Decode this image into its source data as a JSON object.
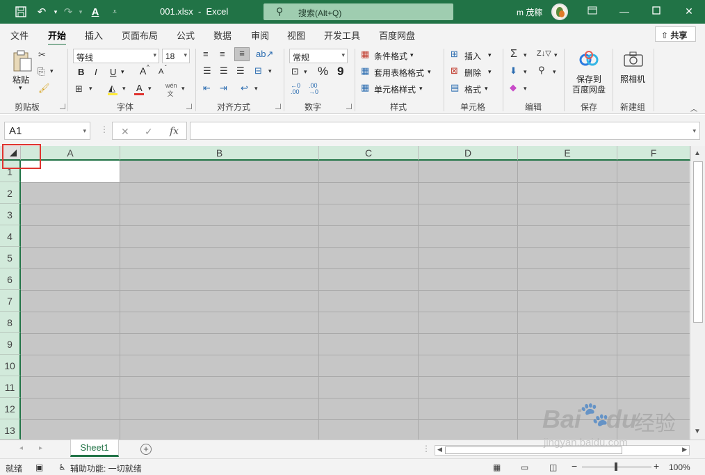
{
  "titlebar": {
    "filename": "001.xlsx",
    "separator": "-",
    "app": "Excel",
    "search_placeholder": "搜索(Alt+Q)",
    "user": "m 茂稼"
  },
  "tabs": [
    "文件",
    "开始",
    "插入",
    "页面布局",
    "公式",
    "数据",
    "审阅",
    "视图",
    "开发工具",
    "百度网盘"
  ],
  "share": "共享",
  "ribbon": {
    "clipboard": {
      "paste": "粘贴",
      "label": "剪贴板"
    },
    "font": {
      "name": "等线",
      "size": "18",
      "bold": "B",
      "italic": "I",
      "underline": "U",
      "grow": "A",
      "shrink": "A",
      "label": "字体"
    },
    "alignment": {
      "label": "对齐方式"
    },
    "number": {
      "format": "常规",
      "percent": "%",
      "comma": "9",
      "label": "数字"
    },
    "styles": {
      "conditional": "条件格式",
      "table": "套用表格格式",
      "cell": "单元格样式",
      "label": "样式"
    },
    "cells": {
      "insert": "插入",
      "delete": "删除",
      "format": "格式",
      "label": "单元格"
    },
    "editing": {
      "label": "编辑"
    },
    "save": {
      "line1": "保存到",
      "line2": "百度网盘",
      "label": "保存"
    },
    "camera": {
      "name": "照相机",
      "label": "新建组"
    }
  },
  "formula_bar": {
    "namebox": "A1",
    "fx": "fx",
    "value": ""
  },
  "columns": [
    "A",
    "B",
    "C",
    "D",
    "E",
    "F"
  ],
  "rows": [
    "1",
    "2",
    "3",
    "4",
    "5",
    "6",
    "7",
    "8",
    "9",
    "10",
    "11",
    "12",
    "13"
  ],
  "sheet": {
    "name": "Sheet1"
  },
  "status": {
    "ready": "就绪",
    "accessibility": "辅助功能: 一切就绪",
    "zoom": "100%"
  },
  "watermark": {
    "brand": "Bai",
    "brand2": "du",
    "text": "经验",
    "url": "jingyan.baidu.com"
  }
}
